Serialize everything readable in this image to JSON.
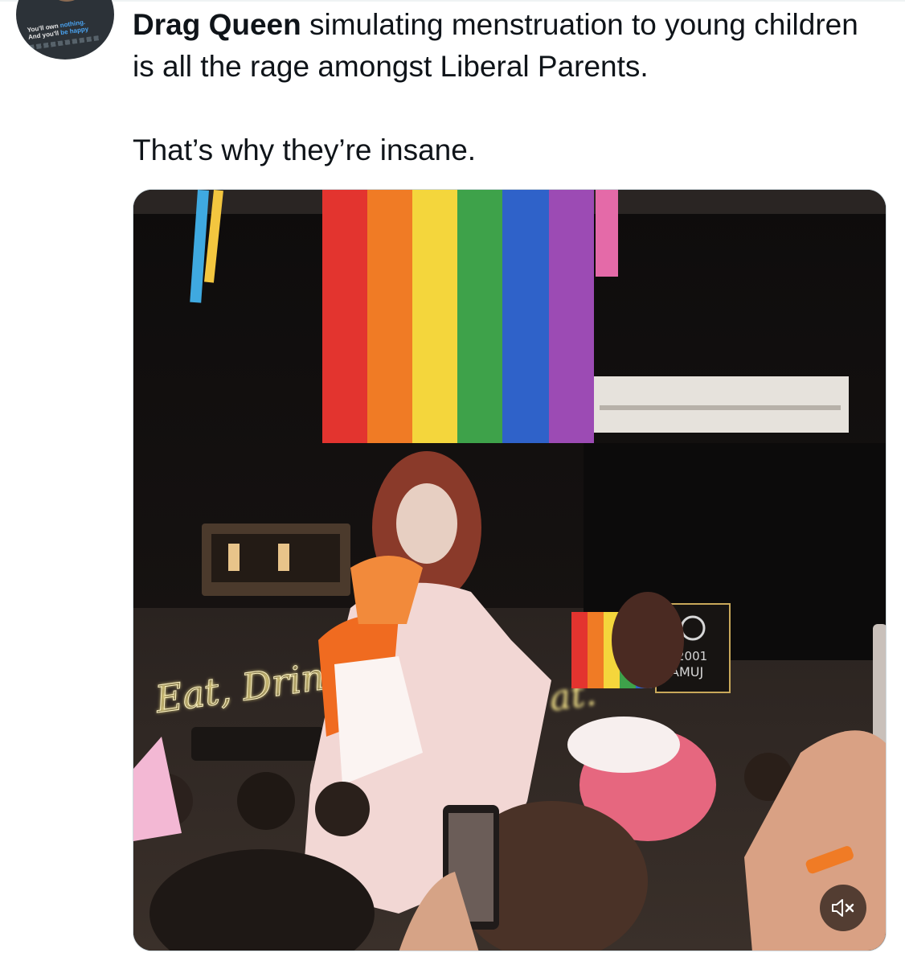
{
  "tweet": {
    "author_avatar_caption": {
      "line1_a": "You'll own ",
      "line1_b": "nothing.",
      "line2_a": "And you'll ",
      "line2_b": "be happy"
    },
    "text_bold": "Drag Queen",
    "text_rest": " simulating menstruation to young children is all the rage amongst Liberal Parents.",
    "text_line2": "That’s why they’re insane."
  },
  "media": {
    "type": "video",
    "sign_text": "Eat, Drin",
    "sign_text_right": "at.",
    "venue_sign_line1": "2001",
    "venue_sign_line2": "AMUJ",
    "mute_icon": "speaker-muted-icon"
  },
  "colors": {
    "text": "#0f1419",
    "border": "#cfd9de",
    "neon": "#f7e58a"
  }
}
